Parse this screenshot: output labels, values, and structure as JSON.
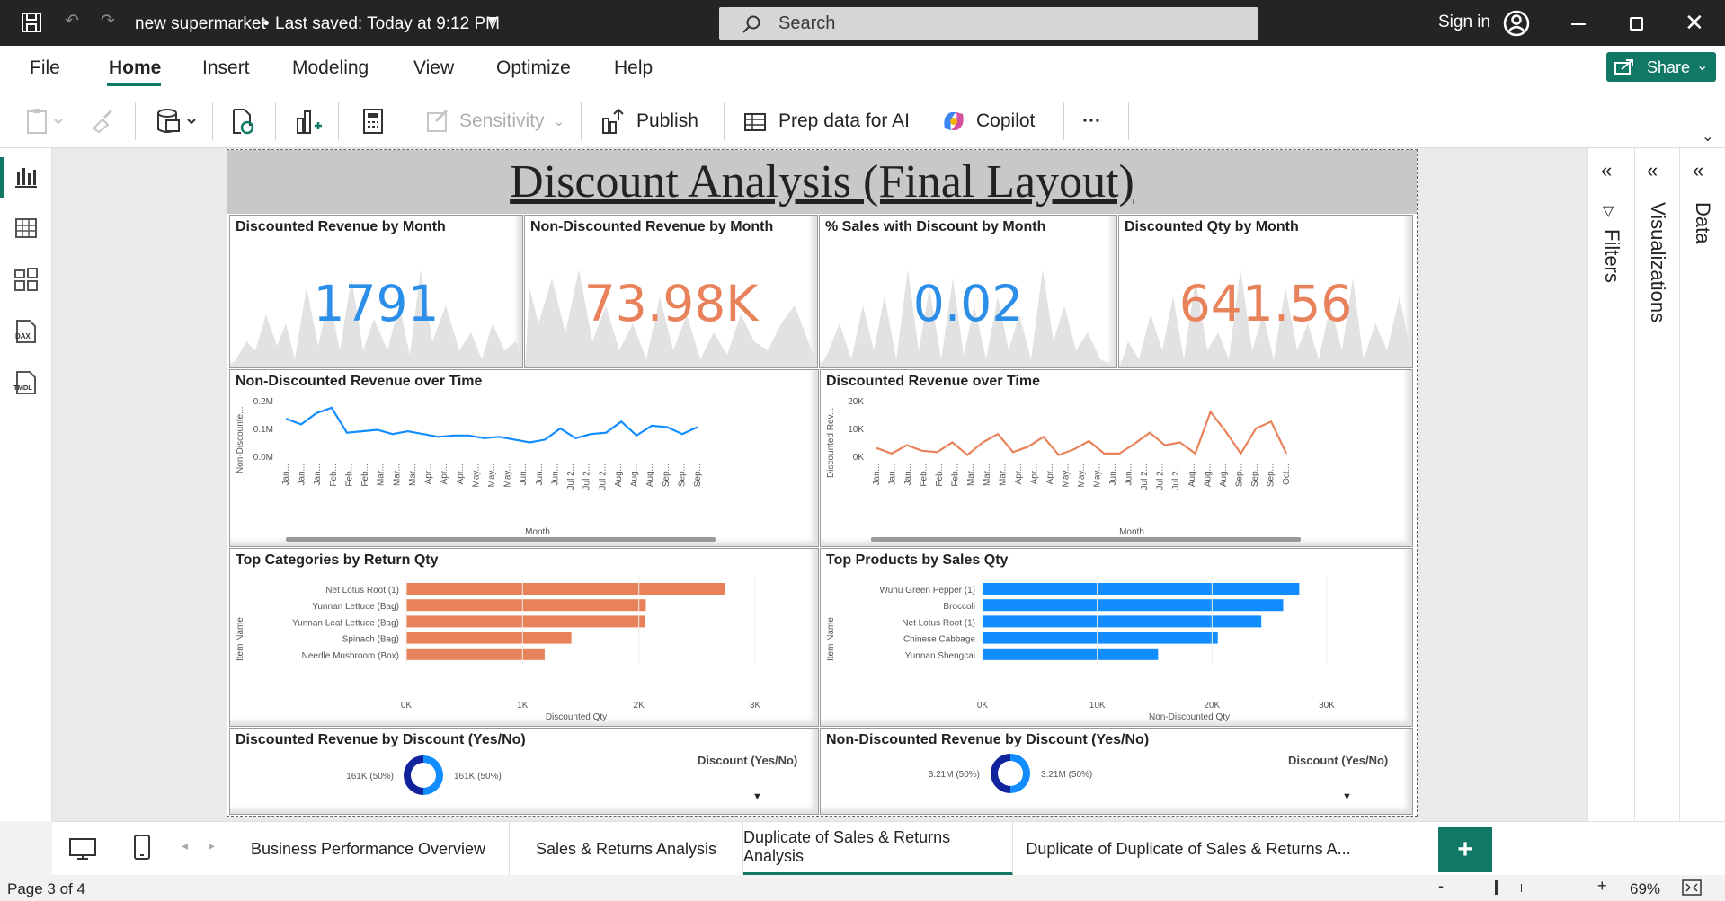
{
  "window": {
    "title": "new supermarket",
    "saved": "Last saved: Today at 9:12 PM",
    "search_placeholder": "Search",
    "signin": "Sign in"
  },
  "menu": [
    "File",
    "Home",
    "Insert",
    "Modeling",
    "View",
    "Optimize",
    "Help"
  ],
  "share_label": "Share",
  "ribbon": {
    "sensitivity": "Sensitivity",
    "publish": "Publish",
    "prep": "Prep data for AI",
    "copilot": "Copilot",
    "more": "···"
  },
  "report": {
    "title": "Discount Analysis (Final Layout)",
    "kpis": [
      {
        "title": "Discounted Revenue by Month",
        "value": "1791",
        "color": "#2b8ee8"
      },
      {
        "title": "Non-Discounted Revenue by Month",
        "value": "73.98K",
        "color": "#e8825a"
      },
      {
        "title": "% Sales with Discount by Month",
        "value": "0.02",
        "color": "#2b8ee8"
      },
      {
        "title": "Discounted Qty by Month",
        "value": "641.56",
        "color": "#e8825a"
      }
    ],
    "line_left": {
      "title": "Non-Discounted Revenue over Time",
      "ylabel": "Non-Discounte...",
      "xlabel": "Month",
      "yticks": [
        "0.2M",
        "0.1M",
        "0.0M"
      ],
      "xticks": [
        "Jan...",
        "Jan...",
        "Jan...",
        "Feb...",
        "Feb...",
        "Feb...",
        "Mar...",
        "Mar...",
        "Mar...",
        "Apr...",
        "Apr...",
        "Apr...",
        "May...",
        "May...",
        "May...",
        "Jun...",
        "Jun...",
        "Jun...",
        "Jul 2...",
        "Jul 2...",
        "Jul 2...",
        "Aug...",
        "Aug...",
        "Aug...",
        "Sep...",
        "Sep...",
        "Sep..."
      ]
    },
    "line_right": {
      "title": "Discounted Revenue over Time",
      "ylabel": "Discounted Rev...",
      "xlabel": "Month",
      "yticks": [
        "20K",
        "10K",
        "0K"
      ],
      "xticks": [
        "Jan...",
        "Jan...",
        "Jan...",
        "Feb...",
        "Feb...",
        "Feb...",
        "Mar...",
        "Mar...",
        "Mar...",
        "Apr...",
        "Apr...",
        "Apr...",
        "May...",
        "May...",
        "May...",
        "Jun...",
        "Jun...",
        "Jul 2...",
        "Jul 2...",
        "Jul 2...",
        "Aug...",
        "Aug...",
        "Aug...",
        "Sep...",
        "Sep...",
        "Sep...",
        "Oct..."
      ]
    },
    "bar_left": {
      "title": "Top Categories by Return Qty",
      "ylabel": "Item Name",
      "xlabel": "Discounted Qty",
      "xticks": [
        "0K",
        "1K",
        "2K",
        "3K"
      ]
    },
    "bar_right": {
      "title": "Top Products by Sales Qty",
      "ylabel": "Item Name",
      "xlabel": "Non-Discounted Qty",
      "xticks": [
        "0K",
        "10K",
        "20K",
        "30K"
      ]
    },
    "donut_left": {
      "title": "Discounted Revenue by Discount (Yes/No)",
      "legend": "Discount (Yes/No)",
      "label_left": "161K (50%)",
      "label_right": "161K (50%)"
    },
    "donut_right": {
      "title": "Non-Discounted Revenue by Discount (Yes/No)",
      "legend": "Discount (Yes/No)",
      "label_left": "3.21M (50%)",
      "label_right": "3.21M (50%)"
    }
  },
  "panes": {
    "filters": "Filters",
    "visualizations": "Visualizations",
    "data": "Data"
  },
  "tabs": [
    "Business Performance Overview",
    "Sales & Returns Analysis",
    "Duplicate of Sales & Returns Analysis",
    "Duplicate of Duplicate of Sales & Returns A..."
  ],
  "status": {
    "page": "Page 3 of 4",
    "zoom": "69%"
  },
  "chart_data": [
    {
      "type": "line",
      "title": "Non-Discounted Revenue over Time",
      "xlabel": "Month",
      "ylabel": "Non-Discounte...",
      "ylim": [
        0,
        0.2
      ],
      "unit": "M",
      "values": [
        0.135,
        0.115,
        0.155,
        0.175,
        0.085,
        0.09,
        0.095,
        0.08,
        0.09,
        0.08,
        0.07,
        0.075,
        0.075,
        0.065,
        0.07,
        0.06,
        0.05,
        0.06,
        0.1,
        0.065,
        0.08,
        0.085,
        0.125,
        0.075,
        0.11,
        0.105,
        0.08,
        0.105
      ]
    },
    {
      "type": "line",
      "title": "Discounted Revenue over Time",
      "xlabel": "Month",
      "ylabel": "Discounted Rev...",
      "ylim": [
        0,
        20000
      ],
      "values": [
        3000,
        1000,
        4000,
        2000,
        1500,
        5000,
        500,
        5000,
        8000,
        1500,
        3500,
        7000,
        500,
        2500,
        5500,
        1000,
        1000,
        4500,
        8500,
        4000,
        5000,
        1000,
        16000,
        9000,
        1000,
        10000,
        12500,
        1000
      ]
    },
    {
      "type": "bar",
      "title": "Top Categories by Return Qty",
      "xlabel": "Discounted Qty",
      "ylabel": "Item Name",
      "xlim": [
        0,
        3000
      ],
      "categories": [
        "Net Lotus Root (1)",
        "Yunnan Lettuce (Bag)",
        "Yunnan Leaf Lettuce (Bag)",
        "Spinach (Bag)",
        "Needle Mushroom (Box)"
      ],
      "values": [
        2740,
        2060,
        2050,
        1420,
        1190
      ],
      "color": "#e8825a"
    },
    {
      "type": "bar",
      "title": "Top Products by Sales Qty",
      "xlabel": "Non-Discounted Qty",
      "ylabel": "Item Name",
      "xlim": [
        0,
        30000
      ],
      "categories": [
        "Wuhu Green Pepper (1)",
        "Broccoli",
        "Net Lotus Root (1)",
        "Chinese Cabbage",
        "Yunnan Shengcai"
      ],
      "values": [
        27600,
        26200,
        24300,
        20500,
        15300
      ],
      "color": "#118dff"
    },
    {
      "type": "pie",
      "title": "Discounted Revenue by Discount (Yes/No)",
      "values": [
        50,
        50
      ]
    },
    {
      "type": "pie",
      "title": "Non-Discounted Revenue by Discount (Yes/No)",
      "values": [
        50,
        50
      ]
    }
  ]
}
